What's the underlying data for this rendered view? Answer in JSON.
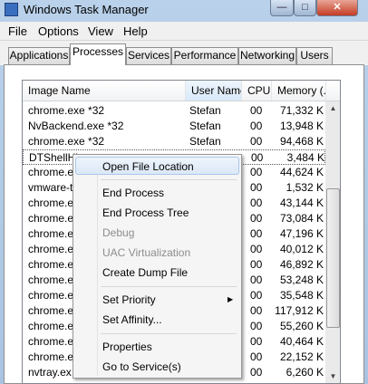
{
  "window": {
    "title": "Windows Task Manager",
    "min_glyph": "—",
    "max_glyph": "□",
    "close_glyph": "✕"
  },
  "menubar": [
    "File",
    "Options",
    "View",
    "Help"
  ],
  "tabs": [
    "Applications",
    "Processes",
    "Services",
    "Performance",
    "Networking",
    "Users"
  ],
  "active_tab": "Processes",
  "columns": {
    "image_name": "Image Name",
    "user_name": "User Name",
    "cpu": "CPU",
    "memory": "Memory (..."
  },
  "rows": [
    {
      "name": "chrome.exe *32",
      "user": "Stefan",
      "cpu": "00",
      "mem": "71,332 K"
    },
    {
      "name": "NvBackend.exe *32",
      "user": "Stefan",
      "cpu": "00",
      "mem": "13,948 K"
    },
    {
      "name": "chrome.exe *32",
      "user": "Stefan",
      "cpu": "00",
      "mem": "94,468 K"
    },
    {
      "name": "DTShellHl",
      "user": "",
      "cpu": "00",
      "mem": "3,484 K"
    },
    {
      "name": "chrome.e",
      "user": "",
      "cpu": "00",
      "mem": "44,624 K"
    },
    {
      "name": "vmware-t",
      "user": "",
      "cpu": "00",
      "mem": "1,532 K"
    },
    {
      "name": "chrome.e",
      "user": "",
      "cpu": "00",
      "mem": "43,144 K"
    },
    {
      "name": "chrome.e",
      "user": "",
      "cpu": "00",
      "mem": "73,084 K"
    },
    {
      "name": "chrome.e",
      "user": "",
      "cpu": "00",
      "mem": "47,196 K"
    },
    {
      "name": "chrome.e",
      "user": "",
      "cpu": "00",
      "mem": "40,012 K"
    },
    {
      "name": "chrome.e",
      "user": "",
      "cpu": "00",
      "mem": "46,892 K"
    },
    {
      "name": "chrome.e",
      "user": "",
      "cpu": "00",
      "mem": "53,248 K"
    },
    {
      "name": "chrome.e",
      "user": "",
      "cpu": "00",
      "mem": "35,548 K"
    },
    {
      "name": "chrome.e",
      "user": "",
      "cpu": "00",
      "mem": "117,912 K"
    },
    {
      "name": "chrome.e",
      "user": "",
      "cpu": "00",
      "mem": "55,260 K"
    },
    {
      "name": "chrome.e",
      "user": "",
      "cpu": "00",
      "mem": "40,464 K"
    },
    {
      "name": "chrome.e",
      "user": "",
      "cpu": "00",
      "mem": "22,152 K"
    },
    {
      "name": "nvtray.ex",
      "user": "",
      "cpu": "00",
      "mem": "6,260 K"
    }
  ],
  "context_menu": [
    {
      "label": "Open File Location",
      "state": "hover"
    },
    {
      "label": "End Process",
      "state": "normal"
    },
    {
      "label": "End Process Tree",
      "state": "normal"
    },
    {
      "label": "Debug",
      "state": "disabled"
    },
    {
      "label": "UAC Virtualization",
      "state": "disabled"
    },
    {
      "label": "Create Dump File",
      "state": "normal"
    },
    {
      "label": "Set Priority",
      "state": "normal",
      "submenu": true
    },
    {
      "label": "Set Affinity...",
      "state": "normal"
    },
    {
      "label": "Properties",
      "state": "normal"
    },
    {
      "label": "Go to Service(s)",
      "state": "normal"
    }
  ],
  "colors": {
    "title_bg": "#b9d1ea",
    "close_red": "#c53c24",
    "hover_blue": "#dbe8f7"
  },
  "icons": {
    "app": "task-manager-icon",
    "submenu": "chevron-right-icon",
    "scroll_up": "arrow-up-icon",
    "scroll_down": "arrow-down-icon"
  }
}
